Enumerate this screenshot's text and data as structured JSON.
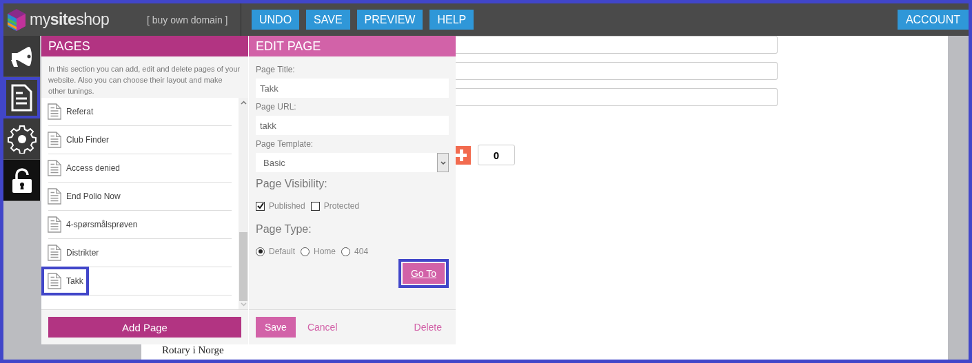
{
  "header": {
    "logo": "my**site**shop",
    "domain_link": "[ buy own domain ]",
    "buttons": [
      "UNDO",
      "SAVE",
      "PREVIEW",
      "HELP"
    ],
    "account_button": "ACCOUNT"
  },
  "sidebar": [
    {
      "kind": "megaphone",
      "highlighted": false
    },
    {
      "kind": "page",
      "highlighted": true
    },
    {
      "kind": "gear",
      "highlighted": false
    },
    {
      "kind": "lock",
      "highlighted": false
    }
  ],
  "pages_panel": {
    "title": "PAGES",
    "description": "In this section you can add, edit and delete pages of your website. Also you can choose their layout and make other tunings.",
    "items": [
      {
        "label": "Referat",
        "highlighted": false
      },
      {
        "label": "Club Finder",
        "highlighted": false
      },
      {
        "label": "Access denied",
        "highlighted": false
      },
      {
        "label": "End Polio Now",
        "highlighted": false
      },
      {
        "label": "4-spørsmålsprøven",
        "highlighted": false
      },
      {
        "label": "Distrikter",
        "highlighted": false
      },
      {
        "label": "Takk",
        "highlighted": true
      }
    ],
    "add_button": "Add Page"
  },
  "edit_panel": {
    "title": "EDIT PAGE",
    "page_title": {
      "label": "Page Title:",
      "value": "Takk"
    },
    "page_url": {
      "label": "Page URL:",
      "value": "takk"
    },
    "template": {
      "label": "Page Template:",
      "value": "Basic"
    },
    "visibility": {
      "heading": "Page Visibility:",
      "options": [
        {
          "label": "Published",
          "checked": true
        },
        {
          "label": "Protected",
          "checked": false
        }
      ]
    },
    "page_type": {
      "heading": "Page Type:",
      "options": [
        {
          "label": "Default",
          "selected": true
        },
        {
          "label": "Home",
          "selected": false
        },
        {
          "label": "404",
          "selected": false
        }
      ]
    },
    "go_to": {
      "label": "Go To",
      "highlighted": true
    },
    "save": "Save",
    "cancel": "Cancel",
    "delete": "Delete"
  },
  "background_page": {
    "counter": "0",
    "footer_text": "Rotary i Norge"
  }
}
